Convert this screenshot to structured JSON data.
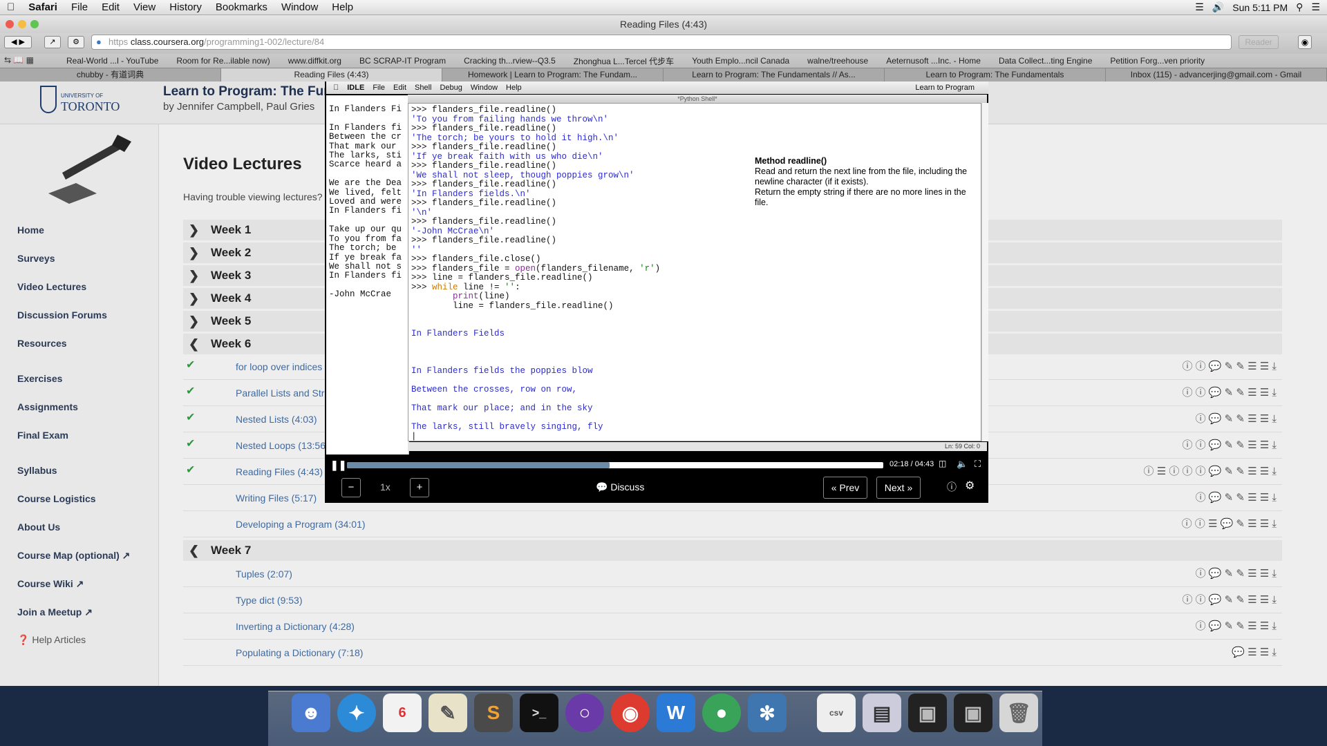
{
  "mac_menubar": {
    "app": "Safari",
    "items": [
      "File",
      "Edit",
      "View",
      "History",
      "Bookmarks",
      "Window",
      "Help"
    ],
    "clock": "Sun 5:11 PM"
  },
  "safari": {
    "window_title": "Reading Files (4:43)",
    "url_scheme": "https",
    "url_host": "class.coursera.org",
    "url_path": "/programming1-002/lecture/84",
    "reader_label": "Reader",
    "bookmarks": [
      "Real-World ...l - YouTube",
      "Room for Re...ilable now)",
      "www.diffkit.org",
      "BC SCRAP-IT Program",
      "Cracking th...rview--Q3.5",
      "Zhonghua L...Tercel 代步车",
      "Youth Emplo...ncil Canada",
      "walne/treehouse",
      "Aeternusoft ...Inc. - Home",
      "Data Collect...ting Engine",
      "Petition Forg...ven priority"
    ],
    "tabs": [
      "chubby - 有道词典",
      "Reading Files (4:43)",
      "Homework | Learn to Program: The Fundam...",
      "Learn to Program: The Fundamentals // As...",
      "Learn to Program: The Fundamentals",
      "Inbox (115) - advancerjing@gmail.com - Gmail"
    ]
  },
  "coursera": {
    "logo_small": "UNIVERSITY OF",
    "logo_big": "TORONTO",
    "course_title": "Learn to Program: The Fun",
    "course_authors": "by Jennifer Campbell, Paul Gries",
    "nav": [
      "Home",
      "Surveys",
      "Video Lectures",
      "Discussion Forums",
      "Resources",
      "Exercises",
      "Assignments",
      "Final Exam",
      "Syllabus",
      "Course Logistics",
      "About Us",
      "Course Map (optional)",
      "Course Wiki",
      "Join a Meetup",
      "Help Articles"
    ],
    "content_title": "Video Lectures",
    "content_sub": "Having trouble viewing lectures?",
    "weeks": [
      "Week 1",
      "Week 2",
      "Week 3",
      "Week 4",
      "Week 5",
      "Week 6",
      "Week 7"
    ],
    "week6_lectures": [
      "for loop over indices",
      "Parallel Lists and Str",
      "Nested Lists (4:03)",
      "Nested Loops (13:56",
      "Reading Files (4:43)",
      "Writing Files (5:17)",
      "Developing a Program (34:01)"
    ],
    "week7_lectures": [
      "Tuples (2:07)",
      "Type dict (9:53)",
      "Inverting a Dictionary (4:28)",
      "Populating a Dictionary (7:18)"
    ]
  },
  "video": {
    "frame_menubar": [
      "IDLE",
      "File",
      "Edit",
      "Shell",
      "Debug",
      "Window",
      "Help"
    ],
    "frame_menubar_right": "Learn to Program",
    "shell_title": "*Python Shell*",
    "text_window": "In Flanders Fi\n\nIn Flanders fi\nBetween the cr\nThat mark our\nThe larks, sti\nScarce heard a\n\nWe are the Dea\nWe lived, felt\nLoved and were\nIn Flanders fi\n\nTake up our qu\nTo you from fa\nThe torch; be\nIf ye break fa\nWe shall not s\nIn Flanders fi\n\n-John McCrae",
    "tooltip_title": "Method readline()",
    "tooltip_line1": "Read and return the next line from the file, including the newline character (if it exists).",
    "tooltip_line2": "Return the empty string if there are no more lines in the file.",
    "status": "Ln: 59 Col: 0",
    "time": "02:18 / 04:43",
    "progress_fraction": 0.49,
    "speed": "1x",
    "discuss": "Discuss",
    "prev": "« Prev",
    "next": "Next »"
  }
}
